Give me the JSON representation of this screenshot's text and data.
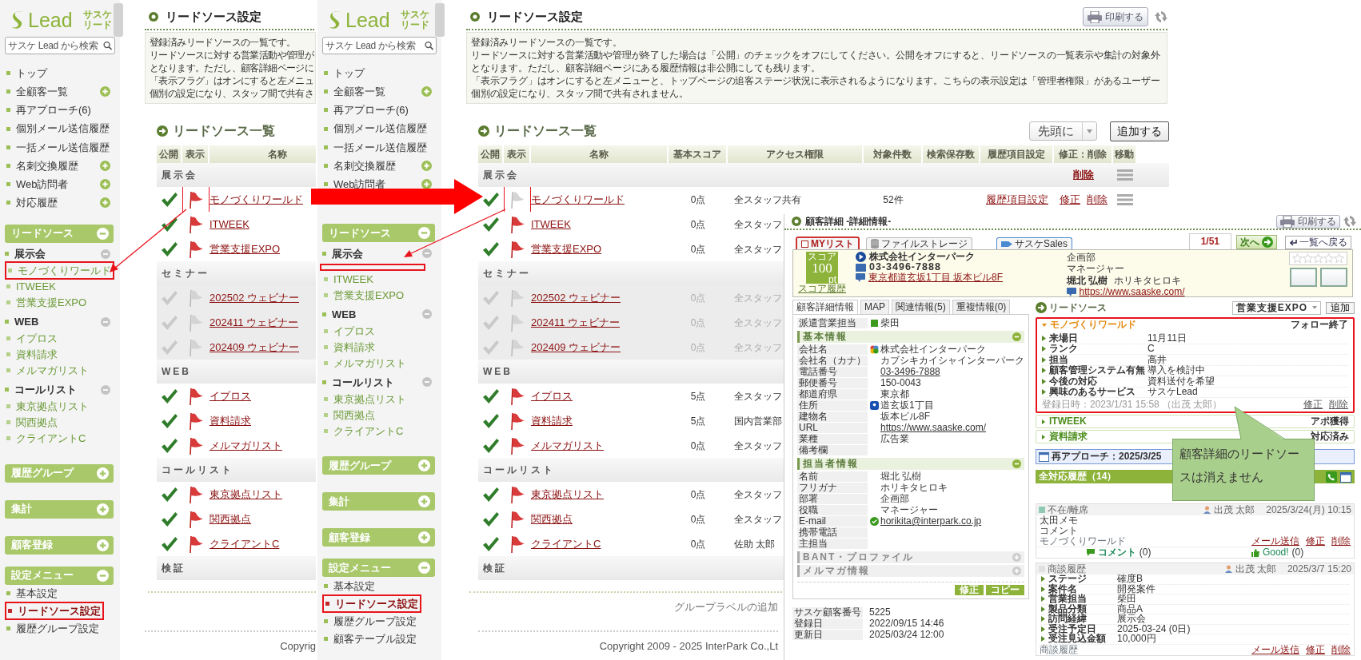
{
  "screens": [
    {
      "sidebar": {
        "logo": {
          "wordmark": "Lead",
          "tagline": [
            "サスケ",
            "リード"
          ]
        },
        "search_placeholder": "サスケ Lead から検索",
        "nav": [
          {
            "label": "トップ",
            "plus": false
          },
          {
            "label": "全顧客一覧",
            "plus": true
          },
          {
            "label": "再アプローチ(6)",
            "plus": false
          },
          {
            "label": "個別メール送信履歴",
            "plus": false
          },
          {
            "label": "一括メール送信履歴",
            "plus": false
          },
          {
            "label": "名刺交換履歴",
            "plus": true
          },
          {
            "label": "Web訪問者",
            "plus": true
          },
          {
            "label": "対応履歴",
            "plus": true
          }
        ],
        "sections": [
          {
            "title": "リードソース",
            "expanded": true,
            "groups": [
              {
                "label": "展示会",
                "items": [
                  {
                    "label": "モノづくりワールド",
                    "highlighted": true
                  },
                  {
                    "label": "ITWEEK",
                    "highlighted": false
                  },
                  {
                    "label": "営業支援EXPO",
                    "highlighted": false
                  }
                ]
              },
              {
                "label": "WEB",
                "items": [
                  {
                    "label": "イプロス",
                    "highlighted": false
                  },
                  {
                    "label": "資料請求",
                    "highlighted": false
                  },
                  {
                    "label": "メルマガリスト",
                    "highlighted": false
                  }
                ]
              },
              {
                "label": "コールリスト",
                "items": [
                  {
                    "label": "東京拠点リスト",
                    "highlighted": false
                  },
                  {
                    "label": "関西拠点",
                    "highlighted": false
                  },
                  {
                    "label": "クライアントC",
                    "highlighted": false
                  }
                ]
              }
            ]
          },
          {
            "title": "履歴グループ",
            "expanded": false
          },
          {
            "title": "集計",
            "expanded": false
          },
          {
            "title": "顧客登録",
            "expanded": false
          },
          {
            "title": "設定メニュー",
            "expanded": true,
            "items": [
              {
                "label": "基本設定",
                "selected": false,
                "highlighted": false
              },
              {
                "label": "リードソース設定",
                "selected": true,
                "highlighted": true
              },
              {
                "label": "履歴グループ設定",
                "selected": false,
                "highlighted": false
              }
            ]
          }
        ]
      },
      "main": {
        "title": "リードソース設定",
        "description": [
          "登録済みリードソースの一覧です。",
          "リードソースに対する営業活動や管理が",
          "となります。ただし、顧客詳細ページに",
          "「表示フラグ」はオンにすると左メニュ",
          "個別の設定になり、スタッフ間で共有さ"
        ],
        "list_title": "リードソース一覧",
        "table": {
          "columns": [
            "公開",
            "表示",
            "名称"
          ],
          "groups": [
            {
              "label": "展示会",
              "rows": [
                {
                  "public": true,
                  "shown": true,
                  "flag_highlighted": true,
                  "name": "モノづくりワールド"
                },
                {
                  "public": true,
                  "shown": true,
                  "flag_highlighted": false,
                  "name": "ITWEEK"
                },
                {
                  "public": true,
                  "shown": true,
                  "flag_highlighted": false,
                  "name": "営業支援EXPO"
                }
              ]
            },
            {
              "label": "セミナー",
              "rows": [
                {
                  "public": false,
                  "shown": false,
                  "flag_highlighted": false,
                  "name": "202502 ウェビナー"
                },
                {
                  "public": false,
                  "shown": false,
                  "flag_highlighted": false,
                  "name": "202411 ウェビナー"
                },
                {
                  "public": false,
                  "shown": false,
                  "flag_highlighted": false,
                  "name": "202409 ウェビナー"
                }
              ]
            },
            {
              "label": "WEB",
              "rows": [
                {
                  "public": true,
                  "shown": true,
                  "flag_highlighted": false,
                  "name": "イプロス"
                },
                {
                  "public": true,
                  "shown": true,
                  "flag_highlighted": false,
                  "name": "資料請求"
                },
                {
                  "public": true,
                  "shown": true,
                  "flag_highlighted": false,
                  "name": "メルマガリスト"
                }
              ]
            },
            {
              "label": "コールリスト",
              "rows": [
                {
                  "public": true,
                  "shown": true,
                  "flag_highlighted": false,
                  "name": "東京拠点リスト"
                },
                {
                  "public": true,
                  "shown": true,
                  "flag_highlighted": false,
                  "name": "関西拠点"
                },
                {
                  "public": true,
                  "shown": true,
                  "flag_highlighted": false,
                  "name": "クライアントC"
                }
              ]
            },
            {
              "label": "検証"
            }
          ]
        },
        "copyright": "Copyrig"
      }
    },
    {
      "sidebar": {
        "logo": {
          "wordmark": "Lead",
          "tagline": [
            "サスケ",
            "リード"
          ]
        },
        "search_placeholder": "サスケ Lead から検索",
        "nav": [
          {
            "label": "トップ",
            "plus": false
          },
          {
            "label": "全顧客一覧",
            "plus": true
          },
          {
            "label": "再アプローチ(6)",
            "plus": false
          },
          {
            "label": "個別メール送信履歴",
            "plus": false
          },
          {
            "label": "一括メール送信履歴",
            "plus": false
          },
          {
            "label": "名刺交換履歴",
            "plus": true
          },
          {
            "label": "Web訪問者",
            "plus": true
          }
        ],
        "sections": [
          {
            "title": "リードソース",
            "expanded": true,
            "groups": [
              {
                "label": "展示会",
                "removed_marker": true,
                "items": [
                  {
                    "label": "ITWEEK",
                    "highlighted": false
                  },
                  {
                    "label": "営業支援EXPO",
                    "highlighted": false
                  }
                ]
              },
              {
                "label": "WEB",
                "items": [
                  {
                    "label": "イプロス",
                    "highlighted": false
                  },
                  {
                    "label": "資料請求",
                    "highlighted": false
                  },
                  {
                    "label": "メルマガリスト",
                    "highlighted": false
                  }
                ]
              },
              {
                "label": "コールリスト",
                "items": [
                  {
                    "label": "東京拠点リスト",
                    "highlighted": false
                  },
                  {
                    "label": "関西拠点",
                    "highlighted": false
                  },
                  {
                    "label": "クライアントC",
                    "highlighted": false
                  }
                ]
              }
            ]
          },
          {
            "title": "履歴グループ",
            "expanded": false
          },
          {
            "title": "集計",
            "expanded": false
          },
          {
            "title": "顧客登録",
            "expanded": false
          },
          {
            "title": "設定メニュー",
            "expanded": true,
            "items": [
              {
                "label": "基本設定",
                "selected": false,
                "highlighted": false
              },
              {
                "label": "リードソース設定",
                "selected": true,
                "highlighted": true
              },
              {
                "label": "履歴グループ設定",
                "selected": false,
                "highlighted": false
              },
              {
                "label": "顧客テーブル設定",
                "selected": false,
                "highlighted": false
              }
            ]
          }
        ]
      },
      "main": {
        "title": "リードソース設定",
        "print_button": "印刷する",
        "description": [
          "登録済みリードソースの一覧です。",
          "リードソースに対する営業活動や管理が終了した場合は「公開」のチェックをオフにしてください。公開をオフにすると、リードソースの一覧表示や集計の対象外",
          "となります。ただし、顧客詳細ページにある履歴情報は非公開にしても残ります。",
          "「表示フラグ」はオンにすると左メニューと、トップページの追客ステージ状況に表示されるようになります。こちらの表示設定は「管理者権限」があるユーザー",
          "個別の設定になり、スタッフ間で共有されません。"
        ],
        "list_title": "リードソース一覧",
        "order_select": "先頭に",
        "add_button": "追加する",
        "table": {
          "columns": [
            "公開",
            "表示",
            "名称",
            "基本スコア",
            "アクセス権限",
            "対象件数",
            "検索保存数",
            "履歴項目設定",
            "修正：削除",
            "移動"
          ],
          "groups": [
            {
              "label": "展示会",
              "delete_link": "削除",
              "movable": true,
              "rows": [
                {
                  "public": true,
                  "shown": false,
                  "flag_highlighted": true,
                  "name": "モノづくりワールド",
                  "score": "0点",
                  "access": "全スタッフ共有",
                  "count": "52件",
                  "history_link": "履歴項目設定",
                  "edit_link": "修正",
                  "delete_link": "削除",
                  "movable": true
                },
                {
                  "public": true,
                  "shown": true,
                  "flag_highlighted": false,
                  "name": "ITWEEK",
                  "score": "0点",
                  "access": "全スタッフ"
                },
                {
                  "public": true,
                  "shown": true,
                  "flag_highlighted": false,
                  "name": "営業支援EXPO",
                  "score": "0点",
                  "access": "全スタッフ"
                }
              ]
            },
            {
              "label": "セミナー",
              "rows": [
                {
                  "public": false,
                  "shown": false,
                  "flag_highlighted": false,
                  "name": "202502 ウェビナー",
                  "score": "0点",
                  "access": "全スタッフ"
                },
                {
                  "public": false,
                  "shown": false,
                  "flag_highlighted": false,
                  "name": "202411 ウェビナー",
                  "score": "0点",
                  "access": "全スタッフ"
                },
                {
                  "public": false,
                  "shown": false,
                  "flag_highlighted": false,
                  "name": "202409 ウェビナー",
                  "score": "0点",
                  "access": "全スタッフ"
                }
              ]
            },
            {
              "label": "WEB",
              "rows": [
                {
                  "public": true,
                  "shown": true,
                  "flag_highlighted": false,
                  "name": "イプロス",
                  "score": "5点",
                  "access": "全スタッフ"
                },
                {
                  "public": true,
                  "shown": true,
                  "flag_highlighted": false,
                  "name": "資料請求",
                  "score": "5点",
                  "access": "国内営業部"
                },
                {
                  "public": true,
                  "shown": true,
                  "flag_highlighted": false,
                  "name": "メルマガリスト",
                  "score": "0点",
                  "access": "全スタッフ"
                }
              ]
            },
            {
              "label": "コールリスト",
              "rows": [
                {
                  "public": true,
                  "shown": true,
                  "flag_highlighted": false,
                  "name": "東京拠点リスト",
                  "score": "0点",
                  "access": "全スタッフ"
                },
                {
                  "public": true,
                  "shown": true,
                  "flag_highlighted": false,
                  "name": "関西拠点",
                  "score": "0点",
                  "access": "全スタッフ"
                },
                {
                  "public": true,
                  "shown": true,
                  "flag_highlighted": false,
                  "name": "クライアントC",
                  "score": "0点",
                  "access": "佐助 太郎"
                }
              ]
            },
            {
              "label": "検証"
            }
          ]
        },
        "add_group_label": "グループラベルの追加",
        "copyright": "Copyright 2009 - 2025 InterPark Co.,Lt"
      }
    }
  ],
  "detail": {
    "title": "顧客詳細 -詳細情報-",
    "print_button": "印刷する",
    "top_tabs": [
      {
        "kind": "checkbox",
        "label": "MYリスト",
        "checked": false
      },
      {
        "kind": "storage",
        "label": "ファイルストレージ"
      },
      {
        "kind": "sales",
        "label": "サスケSales"
      }
    ],
    "pager": {
      "position": "1/51",
      "next": "次へ",
      "back": "一覧へ戻る"
    },
    "score": {
      "label": "スコア",
      "value": "100",
      "unit": "pt",
      "history_link": "スコア履歴"
    },
    "company": {
      "name": "株式会社インターパーク",
      "tel": "03-3496-7888",
      "address": "東京都道玄坂1丁目 坂本ビル8F"
    },
    "contact": {
      "department": "企画部",
      "title": "マネージャー",
      "name": "堀北 弘樹",
      "kana": "ホリキタヒロキ",
      "url": "https://www.saaske.com/"
    },
    "stars": 0,
    "info_tabs": [
      {
        "label": "顧客詳細情報",
        "selected": true
      },
      {
        "label": "MAP",
        "selected": false
      },
      {
        "label": "関連情報(5)",
        "selected": false
      },
      {
        "label": "重複情報(0)",
        "selected": false
      }
    ],
    "assigned": {
      "label": "派遣営業担当",
      "value": "柴田",
      "color": "#3c9a1e"
    },
    "sections": [
      {
        "title": "基本情報",
        "expanded": true,
        "fields": [
          {
            "label": "会社名",
            "value": "株式会社インターパーク",
            "kind": "company"
          },
          {
            "label": "会社名（カナ）",
            "value": "カブシキカイシャインターパーク",
            "kind": "text"
          },
          {
            "label": "電話番号",
            "value": "03-3496-7888",
            "kind": "link"
          },
          {
            "label": "郵便番号",
            "value": "150-0043",
            "kind": "text"
          },
          {
            "label": "都道府県",
            "value": "東京都",
            "kind": "text"
          },
          {
            "label": "住所",
            "value": "道玄坂1丁目",
            "kind": "address"
          },
          {
            "label": "建物名",
            "value": "坂本ビル8F",
            "kind": "text"
          },
          {
            "label": "URL",
            "value": "https://www.saaske.com/",
            "kind": "link"
          },
          {
            "label": "業種",
            "value": "広告業",
            "kind": "text"
          },
          {
            "label": "備考欄",
            "kind": "text"
          }
        ]
      },
      {
        "title": "担当者情報",
        "expanded": true,
        "fields": [
          {
            "label": "名前",
            "value": "堀北 弘樹",
            "kind": "text"
          },
          {
            "label": "フリガナ",
            "value": "ホリキタヒロキ",
            "kind": "text"
          },
          {
            "label": "部署",
            "value": "企画部",
            "kind": "text"
          },
          {
            "label": "役職",
            "value": "マネージャー",
            "kind": "text"
          },
          {
            "label": "E-mail",
            "value": "horikita@interpark.co.jp",
            "kind": "email"
          },
          {
            "label": "携帯電話",
            "kind": "text"
          },
          {
            "label": "主担当",
            "kind": "text"
          }
        ]
      },
      {
        "title": "BANT・プロファイル",
        "expanded": false
      },
      {
        "title": "メルマガ情報",
        "expanded": false
      }
    ],
    "buttons": [
      "修正",
      "コピー"
    ],
    "meta": [
      {
        "label": "サスケ顧客番号",
        "value": "5225"
      },
      {
        "label": "登録日",
        "value": "2022/09/15 14:46"
      },
      {
        "label": "更新日",
        "value": "2025/03/24 12:00"
      }
    ],
    "lead_sources": {
      "title": "リードソース",
      "select": "営業支援EXPO",
      "add_button": "追加",
      "items": [
        {
          "name": "モノづくりワールド",
          "status": "フォロー終了",
          "expanded": true,
          "highlighted": true,
          "fields": [
            {
              "label": "来場日",
              "value": "11月11日"
            },
            {
              "label": "ランク",
              "value": "C"
            },
            {
              "label": "担当",
              "value": "高井"
            },
            {
              "label": "顧客管理システム有無",
              "value": "導入を検討中"
            },
            {
              "label": "今後の対応",
              "value": "資料送付を希望"
            },
            {
              "label": "興味のあるサービス",
              "value": "サスケLead"
            }
          ],
          "registered": "登録日時：2023/1/31 15:58 （出茂 太郎）",
          "edit_link": "修正",
          "delete_link": "削除"
        },
        {
          "name": "ITWEEK",
          "status": "アポ獲得",
          "expanded": false,
          "highlighted": false
        },
        {
          "name": "資料請求",
          "status": "対応済み",
          "expanded": false,
          "highlighted": false
        }
      ]
    },
    "reapproach": "再アプローチ：2025/3/25",
    "history": {
      "title": "全対応履歴（14）",
      "entries": [
        {
          "kind": "memo",
          "type": "不在/離席",
          "color": "#8fc9b3",
          "staff": "出茂 太郎",
          "date": "2025/3/24(月) 10:15",
          "lines": [
            "太田メモ",
            "コメント"
          ],
          "source": "モノづくりワールド",
          "links": [
            "メール送信",
            "修正",
            "削除"
          ],
          "comment": "コメント",
          "comment_count": "(0)",
          "good": "Good!",
          "good_count": "(0)"
        },
        {
          "kind": "deal",
          "type": "商談履歴",
          "color": "#e0e0e0",
          "staff": "出茂 太郎",
          "date": "2025/3/7 15:20",
          "fields": [
            {
              "label": "ステージ",
              "value": "確度B"
            },
            {
              "label": "案件名",
              "value": "開発案件"
            },
            {
              "label": "営業担当",
              "value": "柴田"
            },
            {
              "label": "製品分類",
              "value": "商品A"
            },
            {
              "label": "訪問経緯",
              "value": "展示会"
            },
            {
              "label": "受注予定日",
              "value": "2025-03-24 (0日)"
            },
            {
              "label": "受注見込金額",
              "value": "10,000円"
            }
          ],
          "footer": "商談履歴",
          "links": [
            "メール送信",
            "修正",
            "削除"
          ]
        }
      ]
    }
  },
  "callout": {
    "text": "顧客詳細のリードソースは消えません"
  }
}
